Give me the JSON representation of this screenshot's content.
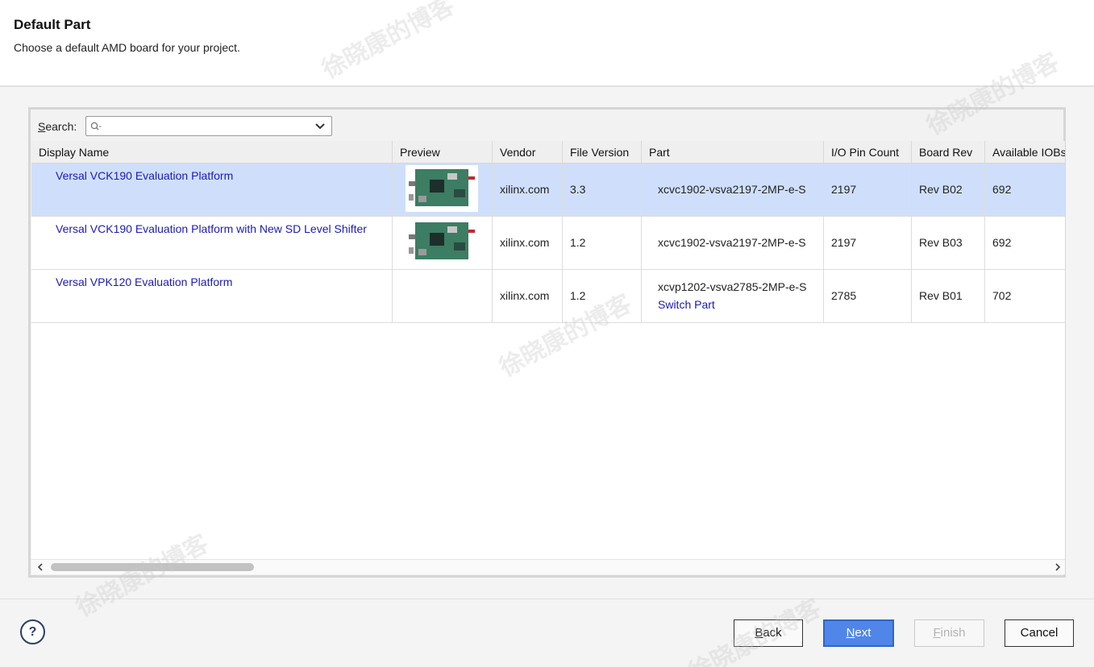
{
  "header": {
    "title": "Default Part",
    "subtitle": "Choose a default AMD board for your project."
  },
  "search": {
    "label_prefix": "S",
    "label_rest": "earch:",
    "value": "",
    "placeholder": "Q-"
  },
  "table": {
    "columns": [
      "Display Name",
      "Preview",
      "Vendor",
      "File Version",
      "Part",
      "I/O Pin Count",
      "Board Rev",
      "Available IOBs"
    ],
    "rows": [
      {
        "display_name": "Versal VCK190 Evaluation Platform",
        "has_preview": true,
        "vendor": "xilinx.com",
        "file_version": "3.3",
        "part": "xcvc1902-vsva2197-2MP-e-S",
        "switch_part": "",
        "io_pin_count": "2197",
        "board_rev": "Rev B02",
        "available_iobs": "692",
        "selected": true
      },
      {
        "display_name": "Versal VCK190 Evaluation Platform with New SD Level Shifter",
        "has_preview": true,
        "vendor": "xilinx.com",
        "file_version": "1.2",
        "part": "xcvc1902-vsva2197-2MP-e-S",
        "switch_part": "",
        "io_pin_count": "2197",
        "board_rev": "Rev B03",
        "available_iobs": "692",
        "selected": false
      },
      {
        "display_name": "Versal VPK120 Evaluation Platform",
        "has_preview": false,
        "vendor": "xilinx.com",
        "file_version": "1.2",
        "part": "xcvp1202-vsva2785-2MP-e-S",
        "switch_part": "Switch Part",
        "io_pin_count": "2785",
        "board_rev": "Rev B01",
        "available_iobs": "702",
        "selected": false
      }
    ]
  },
  "footer": {
    "help_label": "?",
    "back_mnemonic": "B",
    "back_rest": "ack",
    "next_mnemonic": "N",
    "next_rest": "ext",
    "finish_mnemonic": "F",
    "finish_rest": "inish",
    "cancel_label": "Cancel"
  },
  "watermark": "徐晓康的博客",
  "colors": {
    "selected_row": "#cfdffb",
    "link": "#1a1ab8",
    "primary_button": "#4f86e8"
  }
}
